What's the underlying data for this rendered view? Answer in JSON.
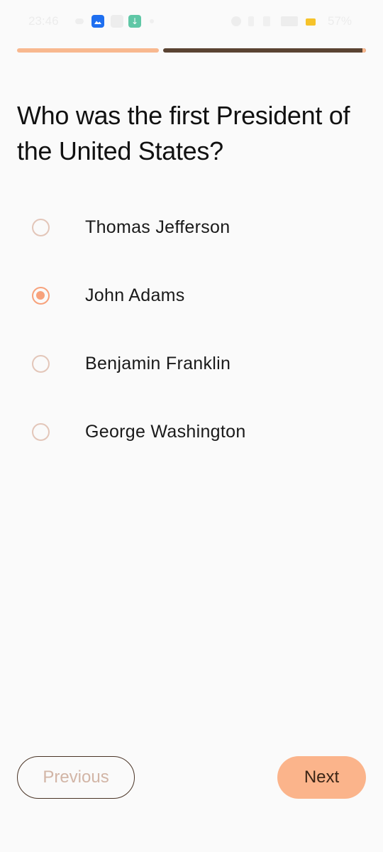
{
  "status_bar": {
    "time": "23:46",
    "battery": "57%",
    "icons": [
      "cloud-icon",
      "app-icon",
      "notification-icon",
      "download-icon",
      "dot-icon",
      "alarm-icon",
      "vibrate-icon",
      "wifi-icon",
      "signal-icon",
      "battery-icon"
    ]
  },
  "progress": {
    "completed_fraction": 0.42,
    "colors": {
      "done": "#f8b88f",
      "remaining": "#5a4332"
    }
  },
  "question": {
    "text": "Who was the first President of the United States?"
  },
  "options": [
    {
      "label": "Thomas Jefferson",
      "selected": false
    },
    {
      "label": "John Adams",
      "selected": true
    },
    {
      "label": "Benjamin Franklin",
      "selected": false
    },
    {
      "label": "George Washington",
      "selected": false
    }
  ],
  "buttons": {
    "previous": "Previous",
    "next": "Next"
  },
  "colors": {
    "accent": "#f7a27c",
    "next_button": "#fbb48b",
    "radio_unselected": "#e3c6b9",
    "background": "#fafafa"
  }
}
